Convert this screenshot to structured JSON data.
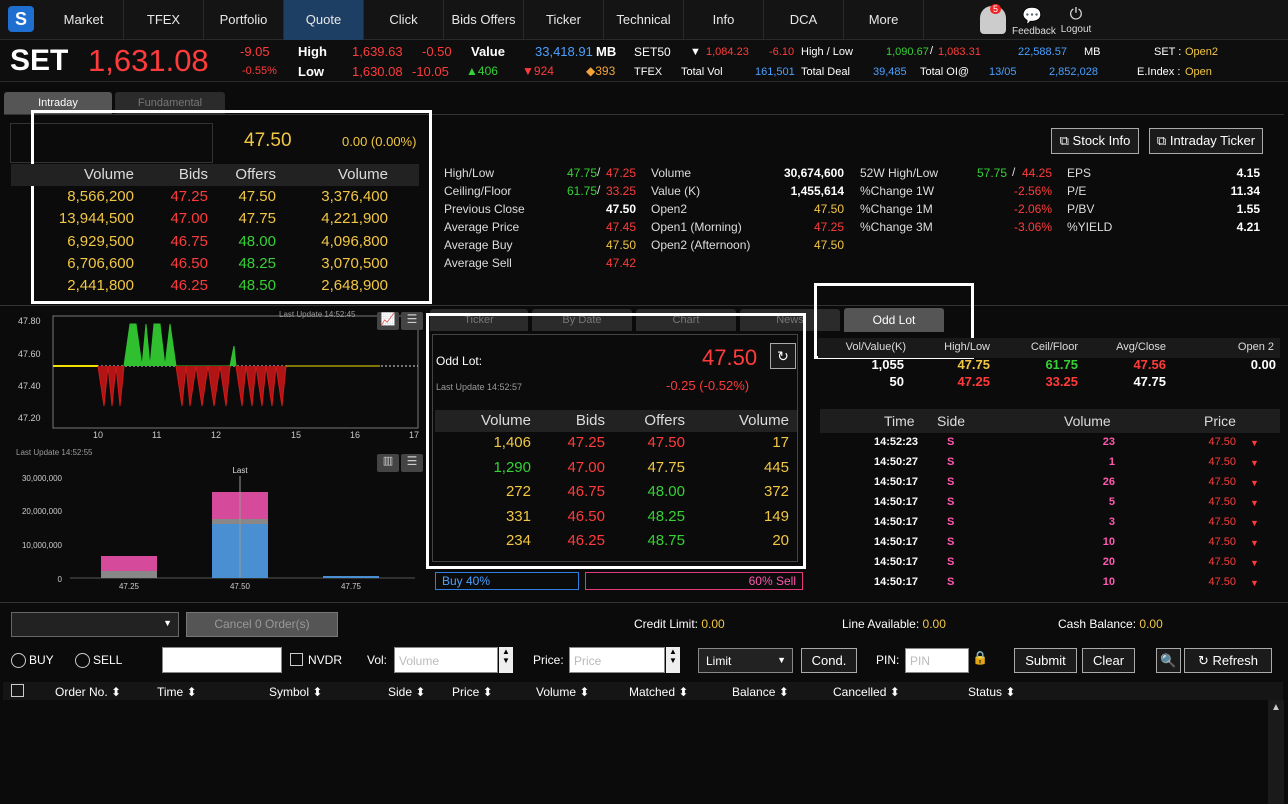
{
  "nav": {
    "items": [
      "Market",
      "TFEX",
      "Portfolio",
      "Quote",
      "Click",
      "Bids Offers",
      "Ticker",
      "Technical",
      "Info",
      "DCA",
      "More"
    ],
    "active": "Quote",
    "feedback": "Feedback",
    "logout": "Logout",
    "badge": "5"
  },
  "index": {
    "name": "SET",
    "value": "1,631.08",
    "chg": "-9.05",
    "chg_pct": "-0.55%",
    "high_label": "High",
    "high": "1,639.63",
    "high_chg": "-0.50",
    "low_label": "Low",
    "low": "1,630.08",
    "low_chg": "-10.05",
    "value_label": "Value",
    "value_amt": "33,418.91",
    "mb": "MB",
    "up": "406",
    "down": "924",
    "unch": "393",
    "set50": "SET50",
    "set50_val": "1,084.23",
    "set50_chg": "-6.10",
    "hl_label": "High / Low",
    "hl_high": "1,090.67",
    "hl_low": "1,083.31",
    "set50_mb": "22,588.57",
    "mb2": "MB",
    "set_label": "SET :",
    "set_status": "Open2",
    "tfex": "TFEX",
    "totvol_label": "Total Vol",
    "totvol": "161,501",
    "totdeal_label": "Total Deal",
    "totdeal": "39,485",
    "totoi_label": "Total OI@",
    "oi_date": "13/05",
    "oi_val": "2,852,028",
    "eindex_label": "E.Index :",
    "eindex_status": "Open"
  },
  "tabs": {
    "intraday": "Intraday",
    "fundamental": "Fundamental"
  },
  "quote": {
    "price": "47.50",
    "change": "0.00 (0.00%)",
    "headers": [
      "Volume",
      "Bids",
      "Offers",
      "Volume"
    ],
    "rows": [
      [
        "8,566,200",
        "47.25",
        "47.50",
        "3,376,400"
      ],
      [
        "13,944,500",
        "47.00",
        "47.75",
        "4,221,900"
      ],
      [
        "6,929,500",
        "46.75",
        "48.00",
        "4,096,800"
      ],
      [
        "6,706,600",
        "46.50",
        "48.25",
        "3,070,500"
      ],
      [
        "2,441,800",
        "46.25",
        "48.50",
        "2,648,900"
      ]
    ]
  },
  "stats": {
    "hl_label": "High/Low",
    "hl_high": "47.75",
    "hl_low": "47.25",
    "cf_label": "Ceiling/Floor",
    "ceiling": "61.75",
    "floor": "33.25",
    "prev_label": "Previous Close",
    "prev": "47.50",
    "avgp_label": "Average Price",
    "avgp": "47.45",
    "avgb_label": "Average Buy",
    "avgb": "47.50",
    "avgs_label": "Average Sell",
    "avgs": "47.42",
    "vol_label": "Volume",
    "vol": "30,674,600",
    "valk_label": "Value (K)",
    "valk": "1,455,614",
    "open2_label": "Open2",
    "open2": "47.50",
    "open1m_label": "Open1 (Morning)",
    "open1m": "47.25",
    "open2a_label": "Open2 (Afternoon)",
    "open2a": "47.50",
    "w52_label": "52W High/Low",
    "w52h": "57.75",
    "w52l": "44.25",
    "c1w_label": "%Change 1W",
    "c1w": "-2.56%",
    "c1m_label": "%Change 1M",
    "c1m": "-2.06%",
    "c3m_label": "%Change 3M",
    "c3m": "-3.06%",
    "eps_label": "EPS",
    "eps": "4.15",
    "pe_label": "P/E",
    "pe": "11.34",
    "pbv_label": "P/BV",
    "pbv": "1.55",
    "yield_label": "%YIELD",
    "yield": "4.21"
  },
  "buttons": {
    "stock_info": "Stock Info",
    "intraday_ticker": "Intraday Ticker"
  },
  "linechart": {
    "update": "Last Update 14:52:45",
    "yticks": [
      "47.80",
      "47.60",
      "47.40",
      "47.20"
    ],
    "xticks": [
      "10",
      "11",
      "12",
      "15",
      "16",
      "17"
    ]
  },
  "volchart": {
    "update": "Last Update 14:52:55",
    "yticks": [
      "30,000,000",
      "20,000,000",
      "10,000,000",
      "0"
    ],
    "xticks": [
      "47.25",
      "47.50",
      "47.75"
    ],
    "last": "Last"
  },
  "mid_tabs": [
    "Ticker",
    "By Date",
    "Chart",
    "News",
    "Odd Lot"
  ],
  "oddlot": {
    "label": "Odd Lot:",
    "price": "47.50",
    "update": "Last Update 14:52:57",
    "change": "-0.25 (-0.52%)",
    "headers": [
      "Volume",
      "Bids",
      "Offers",
      "Volume"
    ],
    "rows": [
      [
        "1,406",
        "47.25",
        "47.50",
        "17"
      ],
      [
        "1,290",
        "47.00",
        "47.75",
        "445"
      ],
      [
        "272",
        "46.75",
        "48.00",
        "372"
      ],
      [
        "331",
        "46.50",
        "48.25",
        "149"
      ],
      [
        "234",
        "46.25",
        "48.75",
        "20"
      ]
    ]
  },
  "buysell": {
    "buy": "Buy 40%",
    "sell": "60% Sell",
    "buy_pct": 40
  },
  "rightsum": {
    "h": [
      "Vol/Value(K)",
      "High/Low",
      "Ceil/Floor",
      "Avg/Close",
      "Open 2"
    ],
    "r1": [
      "1,055",
      "47.75",
      "61.75",
      "47.56",
      "0.00"
    ],
    "r2": [
      "50",
      "47.25",
      "33.25",
      "47.75",
      ""
    ]
  },
  "ticker": {
    "headers": [
      "Time",
      "Side",
      "Volume",
      "Price"
    ],
    "rows": [
      [
        "14:52:23",
        "S",
        "23",
        "47.50"
      ],
      [
        "14:50:27",
        "S",
        "1",
        "47.50"
      ],
      [
        "14:50:17",
        "S",
        "26",
        "47.50"
      ],
      [
        "14:50:17",
        "S",
        "5",
        "47.50"
      ],
      [
        "14:50:17",
        "S",
        "3",
        "47.50"
      ],
      [
        "14:50:17",
        "S",
        "10",
        "47.50"
      ],
      [
        "14:50:17",
        "S",
        "20",
        "47.50"
      ],
      [
        "14:50:17",
        "S",
        "10",
        "47.50"
      ]
    ]
  },
  "order": {
    "cancel": "Cancel 0 Order(s)",
    "credit_label": "Credit Limit:",
    "credit": "0.00",
    "line_label": "Line Available:",
    "line": "0.00",
    "cash_label": "Cash Balance:",
    "cash": "0.00",
    "buy": "BUY",
    "sell": "SELL",
    "nvdr": "NVDR",
    "vol_label": "Vol:",
    "vol_ph": "Volume",
    "price_label": "Price:",
    "price_ph": "Price",
    "type": "Limit",
    "cond": "Cond.",
    "pin_label": "PIN:",
    "pin_ph": "PIN",
    "submit": "Submit",
    "clear": "Clear",
    "refresh": "Refresh",
    "cols": [
      "Order No.",
      "Time",
      "Symbol",
      "Side",
      "Price",
      "Volume",
      "Matched",
      "Balance",
      "Cancelled",
      "Status"
    ]
  }
}
